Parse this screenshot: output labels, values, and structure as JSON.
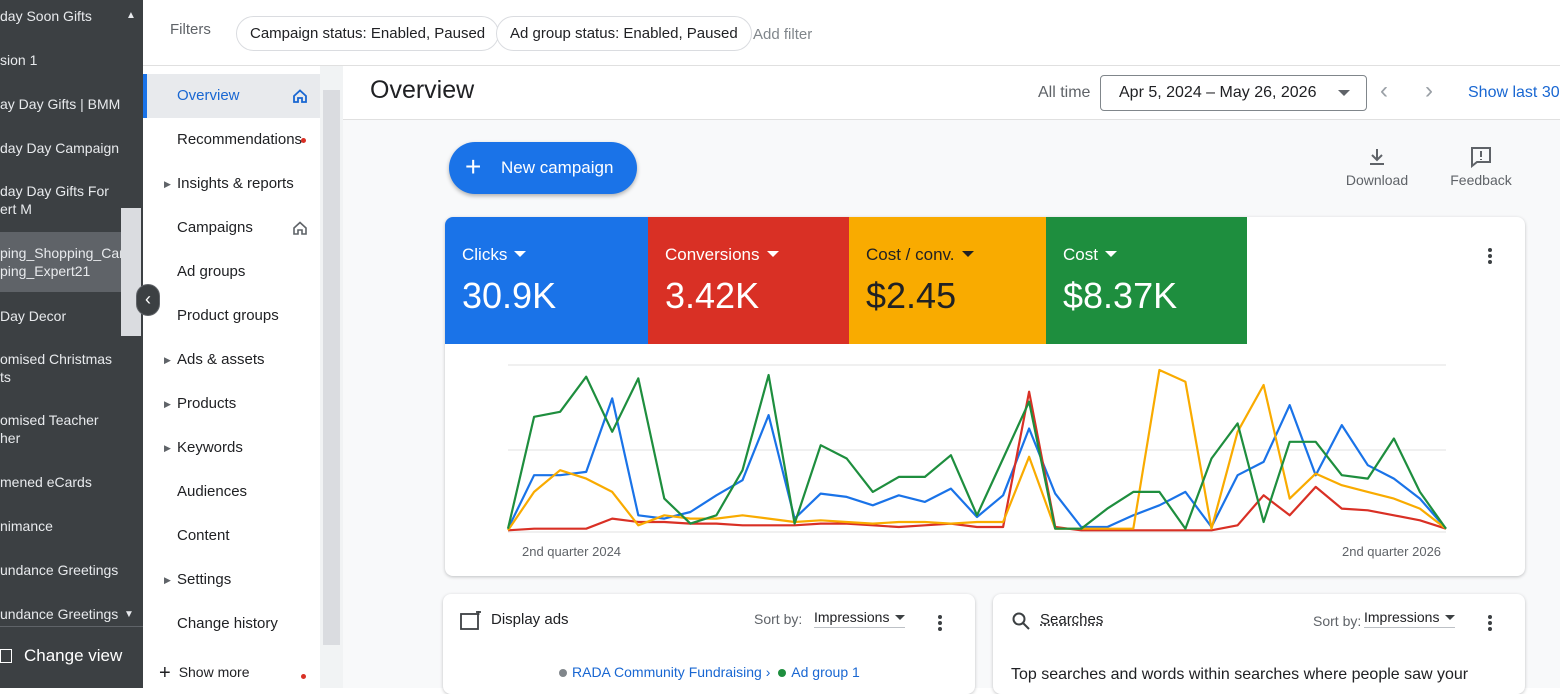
{
  "left_tree": {
    "items": [
      "day Soon Gifts",
      "sion 1",
      "ay Day Gifts | BMM",
      "day Day Campaign",
      "day Day Gifts For\nert M",
      "ping_Shopping_Cam\nping_Expert21",
      "Day Decor",
      "omised Christmas\nts",
      "omised Teacher\nher",
      "mened eCards",
      "nimance",
      "undance Greetings",
      "undance Greetings"
    ],
    "change_view": "Change view"
  },
  "filters": {
    "label": "Filters",
    "chips": [
      "Campaign status: Enabled, Paused",
      "Ad group status: Enabled, Paused"
    ],
    "add_filter": "Add filter"
  },
  "menu": {
    "items": [
      {
        "label": "Overview",
        "expandable": false,
        "home": true,
        "active": true
      },
      {
        "label": "Recommendations",
        "expandable": false,
        "dot": true
      },
      {
        "label": "Insights & reports",
        "expandable": true
      },
      {
        "label": "Campaigns",
        "expandable": false,
        "home": true
      },
      {
        "label": "Ad groups",
        "expandable": false
      },
      {
        "label": "Product groups",
        "expandable": false
      },
      {
        "label": "Ads & assets",
        "expandable": true
      },
      {
        "label": "Products",
        "expandable": true
      },
      {
        "label": "Keywords",
        "expandable": true
      },
      {
        "label": "Audiences",
        "expandable": false
      },
      {
        "label": "Content",
        "expandable": false
      },
      {
        "label": "Settings",
        "expandable": true
      },
      {
        "label": "Change history",
        "expandable": false
      }
    ],
    "show_more": "Show more"
  },
  "header": {
    "title": "Overview",
    "all_time": "All time",
    "date_range": "Apr 5, 2024 – May 26, 2026",
    "show_last": "Show last 30"
  },
  "actions": {
    "new_campaign": "New campaign",
    "download": "Download",
    "feedback": "Feedback"
  },
  "scorecards": [
    {
      "label": "Clicks",
      "value": "30.9K",
      "color": "#1a73e8"
    },
    {
      "label": "Conversions",
      "value": "3.42K",
      "color": "#d93025"
    },
    {
      "label": "Cost / conv.",
      "value": "$2.45",
      "color": "#f9ab00"
    },
    {
      "label": "Cost",
      "value": "$8.37K",
      "color": "#1e8e3e"
    }
  ],
  "chart_data": {
    "type": "line",
    "x_start_label": "2nd quarter 2024",
    "x_end_label": "2nd quarter 2026",
    "grid": true,
    "series": [
      {
        "name": "Clicks",
        "color": "#1a73e8",
        "values": [
          2,
          34,
          34,
          36,
          80,
          10,
          8,
          12,
          22,
          31,
          70,
          8,
          23,
          21,
          16,
          22,
          18,
          26,
          9,
          22,
          62,
          23,
          3,
          3,
          10,
          16,
          24,
          3,
          34,
          42,
          76,
          34,
          64,
          40,
          32,
          20,
          2
        ]
      },
      {
        "name": "Conversions",
        "color": "#d93025",
        "values": [
          1,
          2,
          2,
          2,
          8,
          6,
          6,
          5,
          5,
          4,
          4,
          4,
          5,
          5,
          4,
          3,
          4,
          5,
          3,
          3,
          84,
          3,
          1,
          1,
          1,
          1,
          1,
          1,
          4,
          22,
          10,
          27,
          14,
          13,
          10,
          7,
          2
        ]
      },
      {
        "name": "Cost / conv.",
        "color": "#f9ab00",
        "values": [
          1,
          24,
          37,
          32,
          24,
          4,
          10,
          8,
          8,
          10,
          8,
          6,
          7,
          6,
          5,
          6,
          6,
          5,
          6,
          6,
          45,
          2,
          2,
          2,
          2,
          97,
          90,
          2,
          60,
          88,
          20,
          35,
          28,
          24,
          20,
          14,
          2
        ]
      },
      {
        "name": "Cost",
        "color": "#1e8e3e",
        "values": [
          2,
          69,
          72,
          93,
          60,
          92,
          20,
          5,
          10,
          37,
          94,
          5,
          52,
          44,
          24,
          33,
          33,
          46,
          10,
          44,
          78,
          2,
          2,
          14,
          24,
          24,
          2,
          44,
          65,
          6,
          54,
          54,
          34,
          32,
          56,
          24,
          2
        ]
      }
    ]
  },
  "display_card": {
    "title": "Display ads",
    "sort_label": "Sort by:",
    "sort_value": "Impressions",
    "campaign": "RADA Community Fundraising ›",
    "ad_group": "Ad group 1"
  },
  "searches_card": {
    "title": "Searches",
    "sort_label": "Sort by:",
    "sort_value": "Impressions",
    "description": "Top searches and words within searches where people saw your"
  }
}
